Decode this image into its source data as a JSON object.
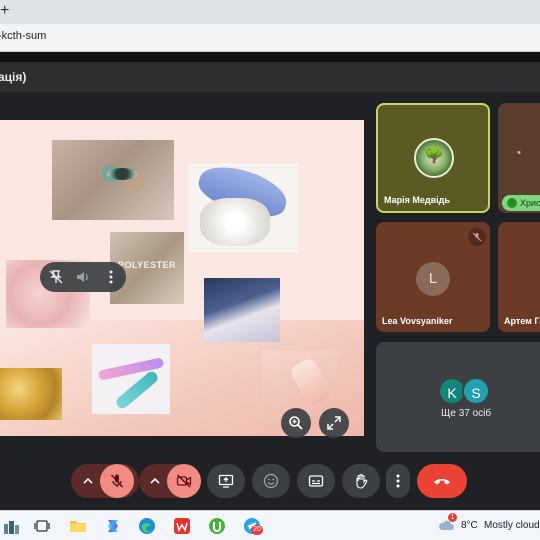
{
  "browser": {
    "tab_plus": "+",
    "url": "-kcth-sum"
  },
  "meet": {
    "title": "ація)"
  },
  "presentation": {
    "fabric_label": "POLYESTER"
  },
  "participants": {
    "maria": {
      "name": "Марія Медвідь"
    },
    "khrys": {
      "name": "Хрис"
    },
    "lea": {
      "name": "Lea Vovsyaniker",
      "initial": "L"
    },
    "artem": {
      "name": "Артем Га"
    },
    "more": {
      "avatars": [
        "K",
        "S"
      ],
      "label": "Ще 37 осіб",
      "colors": [
        "#12857a",
        "#22a0b0"
      ]
    }
  },
  "controls": {
    "chevron": "^",
    "mic_icon": "mic-off-icon",
    "cam_icon": "camera-off-icon"
  },
  "taskbar": {
    "temperature": "8°C",
    "weather": "Mostly cloudy",
    "notification_count": "1",
    "telegram_badge": "20"
  },
  "colors": {
    "end_call": "#ea4335",
    "speaking_border": "#c9d767"
  }
}
